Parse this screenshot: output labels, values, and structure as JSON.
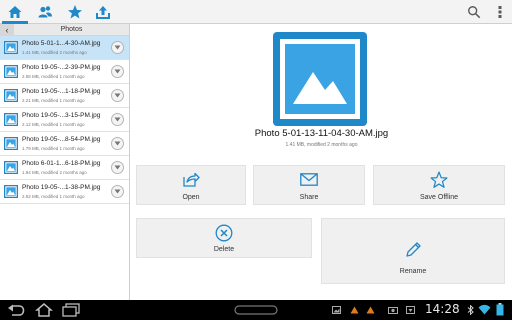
{
  "colors": {
    "accent": "#1e88c9",
    "selected_row": "#c6e3f7",
    "sysbar": "#000000"
  },
  "toolbar": {
    "tabs": [
      {
        "icon": "home-icon",
        "active": true
      },
      {
        "icon": "people-icon",
        "active": false
      },
      {
        "icon": "star-icon",
        "active": false
      },
      {
        "icon": "upload-icon",
        "active": false
      }
    ],
    "right_icons": [
      "search-icon",
      "overflow-menu-icon"
    ]
  },
  "sidebar": {
    "title": "Photos",
    "files": [
      {
        "name": "Photo 5-01-1...4-30-AM.jpg",
        "meta": "1.41 MB, modified 2 months ago",
        "selected": true
      },
      {
        "name": "Photo 19-05-...2-39-PM.jpg",
        "meta": "2.58 MB, modified 1 month ago",
        "selected": false
      },
      {
        "name": "Photo 19-05-...1-18-PM.jpg",
        "meta": "2.21 MB, modified 1 month ago",
        "selected": false
      },
      {
        "name": "Photo 19-05-...3-15-PM.jpg",
        "meta": "2.12 MB, modified 1 month ago",
        "selected": false
      },
      {
        "name": "Photo 19-05-...8-54-PM.jpg",
        "meta": "1.79 MB, modified 1 month ago",
        "selected": false
      },
      {
        "name": "Photo 6-01-1...6-18-PM.jpg",
        "meta": "1.94 MB, modified 2 months ago",
        "selected": false
      },
      {
        "name": "Photo 19-05-...1-38-PM.jpg",
        "meta": "2.62 MB, modified 1 month ago",
        "selected": false
      }
    ]
  },
  "detail": {
    "title": "Photo 5-01-13-11-04-30-AM.jpg",
    "subtitle": "1.41 MB, modified 2 months ago",
    "actions": {
      "open": "Open",
      "share": "Share",
      "save_offline": "Save Offline",
      "delete": "Delete",
      "rename": "Rename"
    }
  },
  "status_bar": {
    "time": "14:28"
  }
}
